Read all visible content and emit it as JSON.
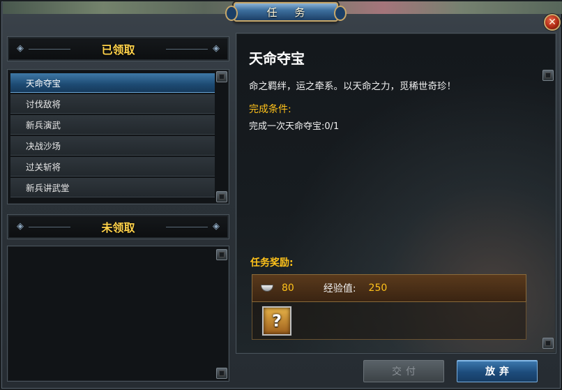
{
  "window": {
    "title": "任 务",
    "close_symbol": "✕"
  },
  "received": {
    "header": "已领取",
    "items": [
      {
        "label": "天命夺宝",
        "selected": true
      },
      {
        "label": "讨伐敌将",
        "selected": false
      },
      {
        "label": "新兵演武",
        "selected": false
      },
      {
        "label": "决战沙场",
        "selected": false
      },
      {
        "label": "过关斩将",
        "selected": false
      },
      {
        "label": "新兵讲武堂",
        "selected": false
      }
    ]
  },
  "unreceived": {
    "header": "未领取",
    "items": []
  },
  "detail": {
    "title": "天命夺宝",
    "description": "命之羁绊，运之牵系。以天命之力，觅稀世奇珍！",
    "condition_label": "完成条件:",
    "condition_text": "完成一次天命夺宝:0/1",
    "reward_label": "任务奖励:",
    "reward": {
      "silver_icon": "silver-ingot-icon",
      "silver_value": "80",
      "exp_label": "经验值:",
      "exp_value": "250",
      "item_icon": "mystery-chest-icon",
      "item_symbol": "?"
    }
  },
  "buttons": {
    "deliver": "交付",
    "abandon": "放弃"
  },
  "colors": {
    "accent_gold": "#ffc21a",
    "selected_blue": "#1d4a72"
  }
}
